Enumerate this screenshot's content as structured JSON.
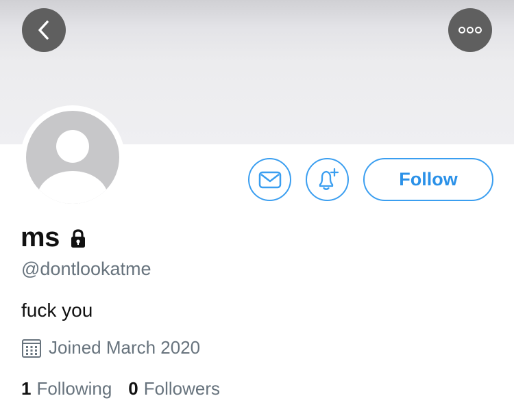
{
  "profile": {
    "display_name": "ms",
    "handle": "@dontlookatme",
    "bio": "fuck you",
    "joined": "Joined March 2020",
    "following_count": "1",
    "following_label": "Following",
    "followers_count": "0",
    "followers_label": "Followers"
  },
  "actions": {
    "follow_label": "Follow"
  },
  "icons": {
    "back": "chevron-left-icon",
    "more": "more-dots-icon",
    "message": "envelope-icon",
    "notify": "bell-plus-icon",
    "lock": "lock-icon",
    "calendar": "calendar-icon"
  },
  "colors": {
    "accent": "#2b91e8",
    "secondary_text": "#67737d",
    "nav_button": "#5f5f5f",
    "avatar_placeholder": "#c7c7c9"
  }
}
